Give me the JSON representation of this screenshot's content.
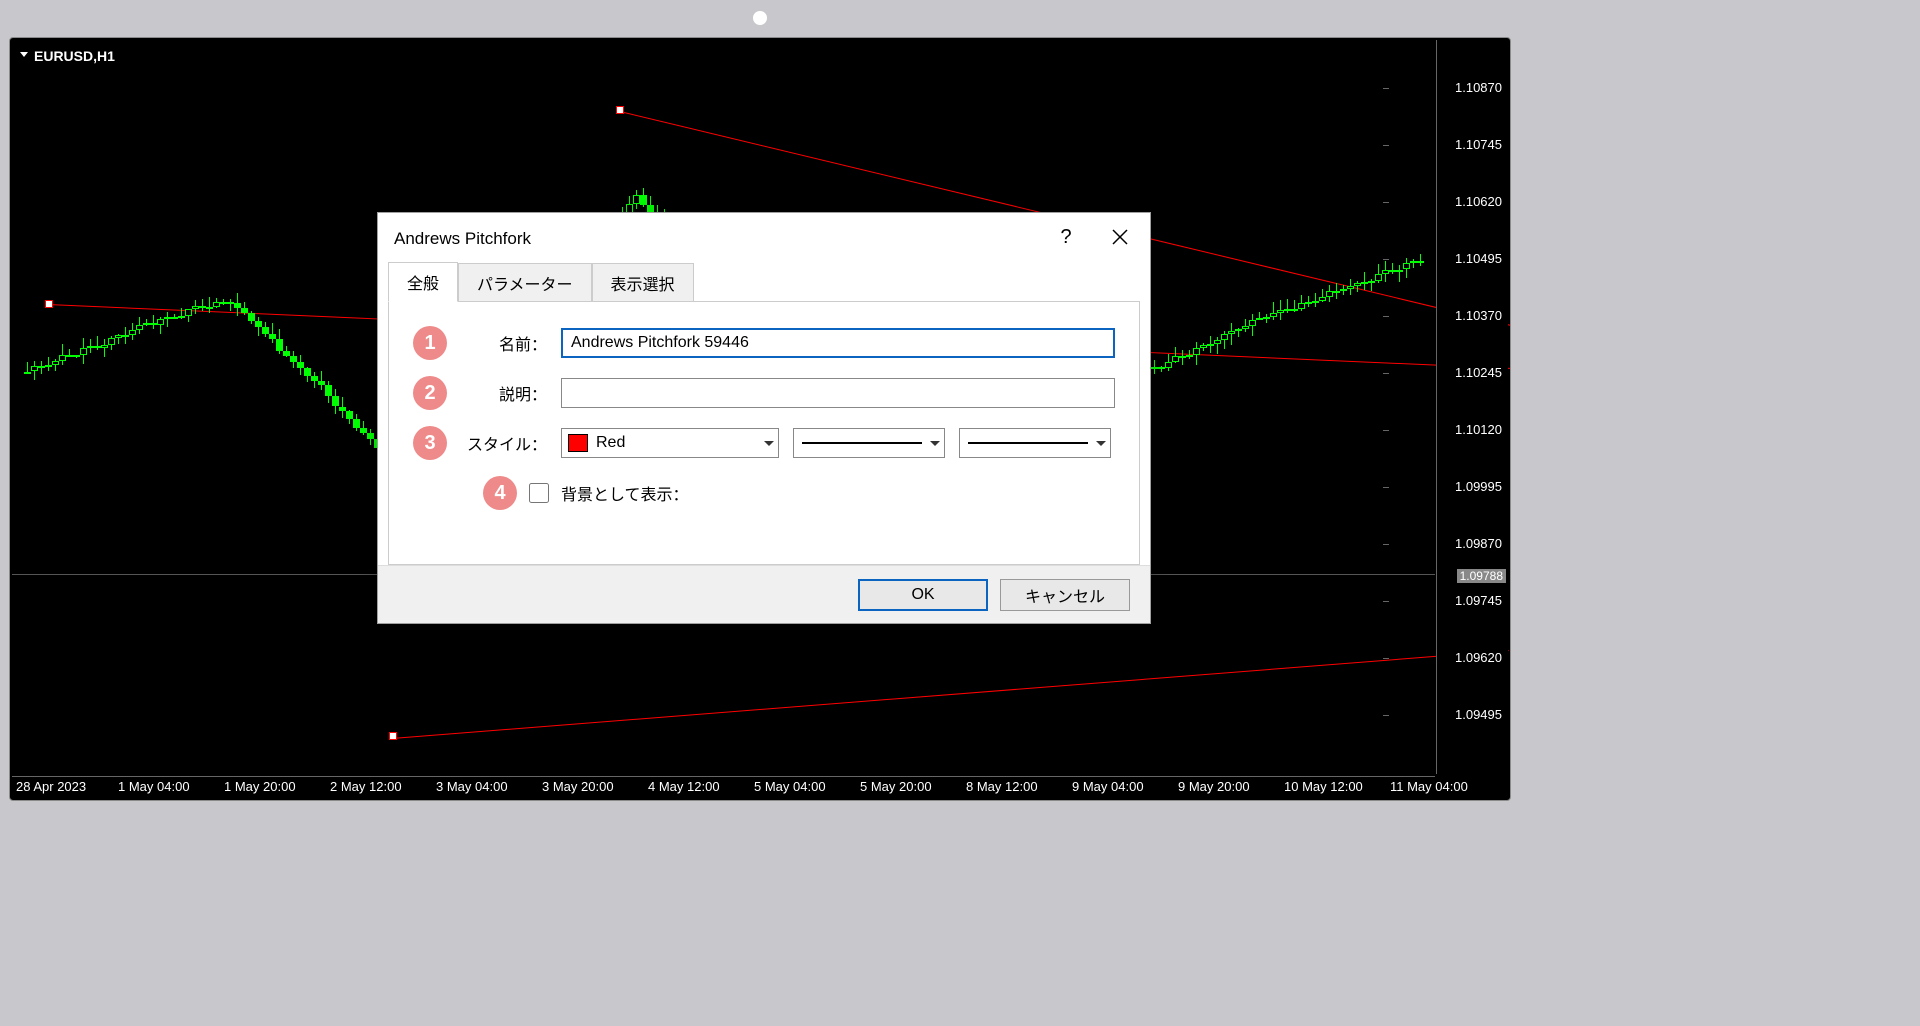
{
  "chart": {
    "symbol": "EURUSD,H1",
    "price_ticks": [
      "1.10870",
      "1.10745",
      "1.10620",
      "1.10495",
      "1.10370",
      "1.10245",
      "1.10120",
      "1.09995",
      "1.09870",
      "1.09745",
      "1.09620",
      "1.09495"
    ],
    "current_price": "1.09788",
    "time_ticks": [
      "28 Apr 2023",
      "1 May 04:00",
      "1 May 20:00",
      "2 May 12:00",
      "3 May 04:00",
      "3 May 20:00",
      "4 May 12:00",
      "5 May 04:00",
      "5 May 20:00",
      "8 May 12:00",
      "9 May 04:00",
      "9 May 20:00",
      "10 May 12:00",
      "11 May 04:00"
    ]
  },
  "dialog": {
    "title": "Andrews Pitchfork",
    "help_label": "?",
    "tabs": {
      "general": "全般",
      "parameters": "パラメーター",
      "display": "表示選択"
    },
    "badges": {
      "b1": "1",
      "b2": "2",
      "b3": "3",
      "b4": "4"
    },
    "labels": {
      "name": "名前：",
      "description": "説明：",
      "style": "スタイル：",
      "background": "背景として表示："
    },
    "values": {
      "name": "Andrews Pitchfork 59446",
      "description": "",
      "color_name": "Red",
      "color_hex": "#ff0000"
    },
    "buttons": {
      "ok": "OK",
      "cancel": "キャンセル"
    }
  }
}
